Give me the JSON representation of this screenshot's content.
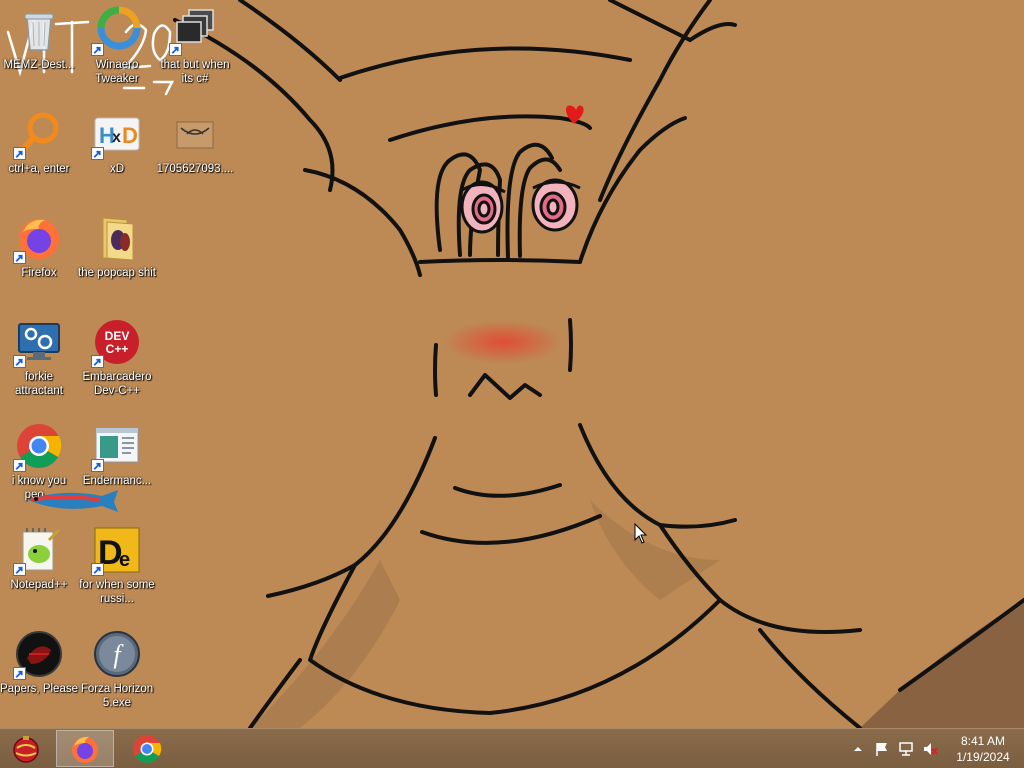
{
  "desktop": {
    "icons": [
      {
        "label": "MEMZ-Dest...",
        "icon": "recycle-bin-icon"
      },
      {
        "label": "Winaero Tweaker",
        "icon": "winaero-tweaker-icon"
      },
      {
        "label": "that but when its c#",
        "icon": "stacked-windows-icon"
      },
      {
        "label": "ctrl+a, enter",
        "icon": "magnifier-orange-icon"
      },
      {
        "label": "xD",
        "icon": "hxd-editor-icon"
      },
      {
        "label": "1705627093....",
        "icon": "image-file-icon"
      },
      {
        "label": "Firefox",
        "icon": "firefox-icon"
      },
      {
        "label": "the popcap shit",
        "icon": "folder-icon"
      },
      {
        "label": "forkie attractant",
        "icon": "monitor-settings-icon"
      },
      {
        "label": "Embarcadero Dev-C++",
        "icon": "devcpp-icon"
      },
      {
        "label": "i know you peo...",
        "icon": "chrome-icon"
      },
      {
        "label": "Endermanc...",
        "icon": "window-app-icon"
      },
      {
        "label": "Notepad++",
        "icon": "notepadpp-icon"
      },
      {
        "label": "for when some russi...",
        "icon": "dependency-walker-icon"
      },
      {
        "label": "Papers, Please",
        "icon": "papers-please-icon"
      },
      {
        "label": "Forza Horizon 5.exe",
        "icon": "flash-icon"
      }
    ],
    "overlay_text": "VIT 2024"
  },
  "taskbar": {
    "start_icon": "start-orb-icon",
    "pinned": [
      {
        "name": "firefox",
        "icon": "firefox-icon",
        "active": true
      },
      {
        "name": "chrome",
        "icon": "chrome-icon",
        "active": false
      }
    ],
    "tray": {
      "icons": [
        "show-hidden-icons-chevron",
        "action-center-flag-icon",
        "network-icon",
        "volume-muted-icon"
      ]
    },
    "clock": {
      "time": "8:41 AM",
      "date": "1/19/2024"
    }
  },
  "colors": {
    "wallpaper": "#bd8a55",
    "wallpaper_shadow": "#7f5a3e",
    "taskbar": "#7a5e40",
    "blush": "#e0523a",
    "eye_pink": "#e58a9b"
  }
}
